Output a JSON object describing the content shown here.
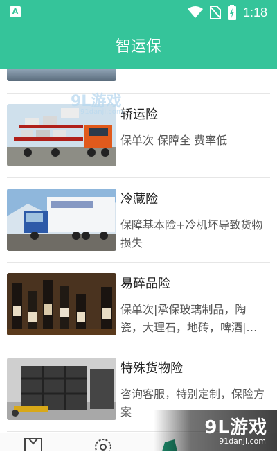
{
  "status_bar": {
    "time": "1:18",
    "left_icon_label": "A",
    "icons": [
      "wifi-icon",
      "no-sim-icon",
      "battery-charging-icon"
    ]
  },
  "app_bar": {
    "title": "智运保"
  },
  "items": [
    {
      "title": "轿运险",
      "desc": "保单次 保障全 费率低",
      "image": "car-carrier-truck"
    },
    {
      "title": "冷藏险",
      "desc": "保障基本险+冷机坏导致货物损失",
      "image": "refrigerated-truck"
    },
    {
      "title": "易碎品险",
      "desc": "保单次|承保玻璃制品，陶瓷，大理石，地砖，啤酒|…",
      "image": "wine-bottles"
    },
    {
      "title": "特殊货物险",
      "desc": "咨询客服，特别定制，保险方案",
      "image": "wooden-crates"
    }
  ],
  "watermark": {
    "brand": "9L游戏",
    "site": "91danji.com"
  },
  "colors": {
    "primary": "#35c49a",
    "divider": "#e6e6e6"
  },
  "bottom_nav": {
    "icons": [
      "policy-icon",
      "service-icon",
      "profile-icon"
    ]
  }
}
